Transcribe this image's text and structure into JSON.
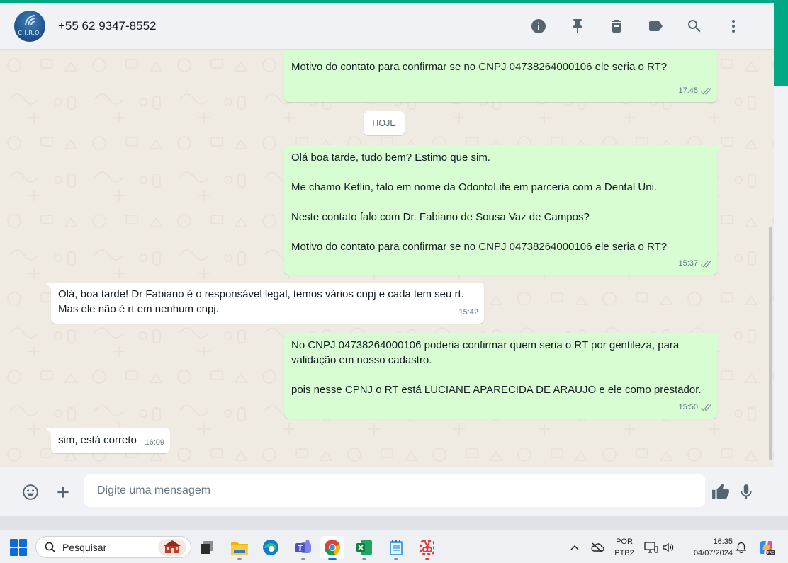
{
  "header": {
    "avatar_text": "C.I.R.O.",
    "contact": "+55 62 9347-8552",
    "icons": [
      "info-icon",
      "pin-icon",
      "trash-icon",
      "label-icon",
      "search-icon",
      "menu-icon"
    ]
  },
  "date_chip": "HOJE",
  "messages": [
    {
      "text": "Motivo do contato para confirmar se no CNPJ 04738264000106 ele seria o RT?",
      "time": "17:45"
    },
    {
      "text": "Olá boa tarde, tudo bem? Estimo que sim.\n\nMe chamo Ketlin, falo em nome da OdontoLife em parceria com a Dental Uni.\n\nNeste contato falo com Dr. Fabiano de Sousa Vaz de Campos?\n\nMotivo do contato para confirmar se no CNPJ 04738264000106 ele seria o RT?",
      "time": "15:37"
    },
    {
      "text": "Olá, boa tarde! Dr Fabiano é o responsável legal, temos vários cnpj e cada tem seu rt.\nMas ele não é rt em nenhum cnpj.",
      "time": "15:42"
    },
    {
      "text": "No CNPJ 04738264000106 poderia confirmar quem seria o RT por gentileza, para\nvalidação em nosso cadastro.\n\npois nesse CPNJ o RT está LUCIANE APARECIDA DE ARAUJO e ele como prestador.",
      "time": "15:50"
    },
    {
      "text": "sim, está correto",
      "time": "16:09"
    }
  ],
  "composer": {
    "placeholder": "Digite uma mensagem"
  },
  "taskbar": {
    "search_label": "Pesquisar",
    "lang_top": "POR",
    "lang_bottom": "PTB2",
    "time": "16:35",
    "date": "04/07/2024"
  },
  "colors": {
    "accent": "#00a884",
    "outgoing_bubble": "#d9fdd3",
    "incoming_bubble": "#ffffff",
    "chat_background": "#efeae2"
  }
}
